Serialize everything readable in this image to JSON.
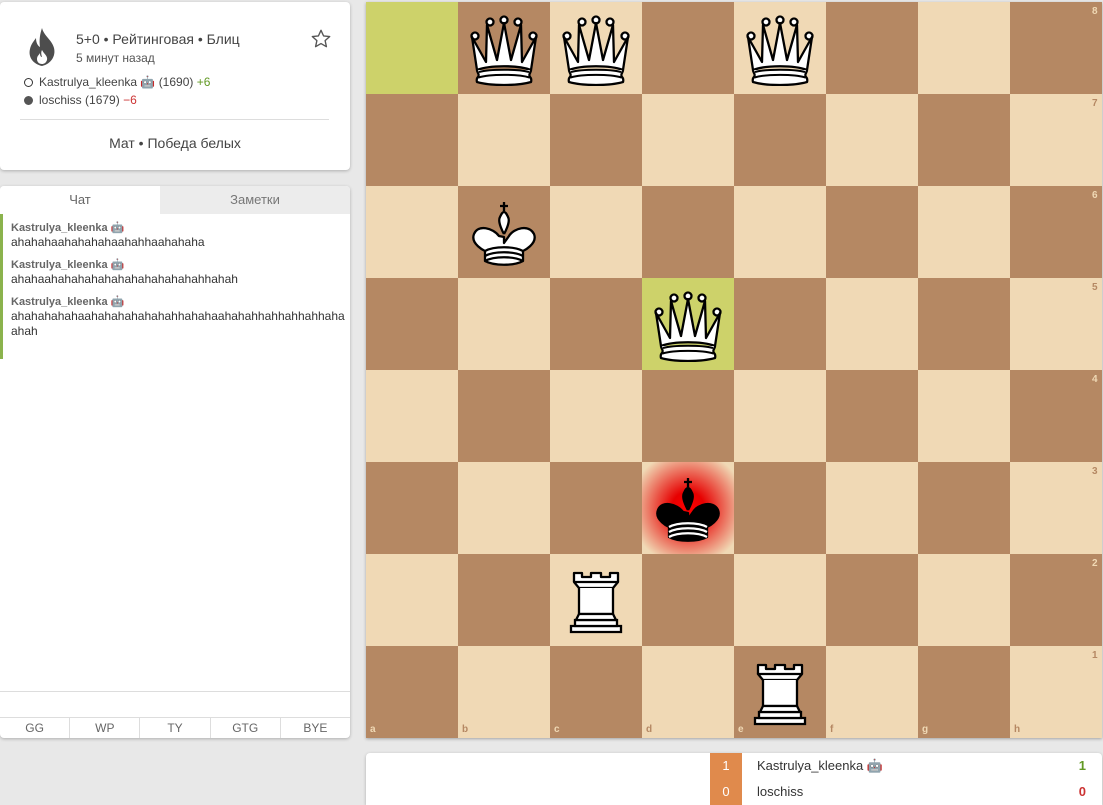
{
  "game": {
    "title": "5+0 • Рейтинговая • Блиц",
    "time_ago": "5 минут назад",
    "white_player": {
      "name": "Kastrulya_kleenka 🤖",
      "rating": "(1690)",
      "diff": "+6"
    },
    "black_player": {
      "name": "loschiss",
      "rating": "(1679)",
      "diff": "−6"
    },
    "result": "Мат • Победа белых"
  },
  "chat": {
    "tabs": [
      "Чат",
      "Заметки"
    ],
    "messages": [
      {
        "author": "Kastrulya_kleenka 🤖",
        "text": "ahahahaahahahahaahahhaahahaha"
      },
      {
        "author": "Kastrulya_kleenka 🤖",
        "text": "ahahaahahahahahahahahahahahahhahah"
      },
      {
        "author": "Kastrulya_kleenka 🤖",
        "text": "ahahahahahaahahahahahahahhahahaahahahhahhahhahhahaahah"
      }
    ],
    "presets": [
      "GG",
      "WP",
      "TY",
      "GTG",
      "BYE"
    ]
  },
  "board": {
    "files": [
      "a",
      "b",
      "c",
      "d",
      "e",
      "f",
      "g",
      "h"
    ],
    "ranks": [
      "8",
      "7",
      "6",
      "5",
      "4",
      "3",
      "2",
      "1"
    ],
    "pieces": [
      {
        "square": "b8",
        "type": "queen",
        "color": "white"
      },
      {
        "square": "c8",
        "type": "queen",
        "color": "white"
      },
      {
        "square": "e8",
        "type": "queen",
        "color": "white"
      },
      {
        "square": "b6",
        "type": "king",
        "color": "white"
      },
      {
        "square": "d5",
        "type": "queen",
        "color": "white"
      },
      {
        "square": "d3",
        "type": "king",
        "color": "black"
      },
      {
        "square": "c2",
        "type": "rook",
        "color": "white"
      },
      {
        "square": "e1",
        "type": "rook",
        "color": "white"
      }
    ],
    "last_move": [
      "a8",
      "d5"
    ],
    "check_square": "d3"
  },
  "scoreboard": [
    {
      "num": "1",
      "name": "Kastrulya_kleenka 🤖",
      "score": "1",
      "color": "#629924"
    },
    {
      "num": "0",
      "name": "loschiss",
      "score": "0",
      "color": "#cc3333"
    }
  ]
}
